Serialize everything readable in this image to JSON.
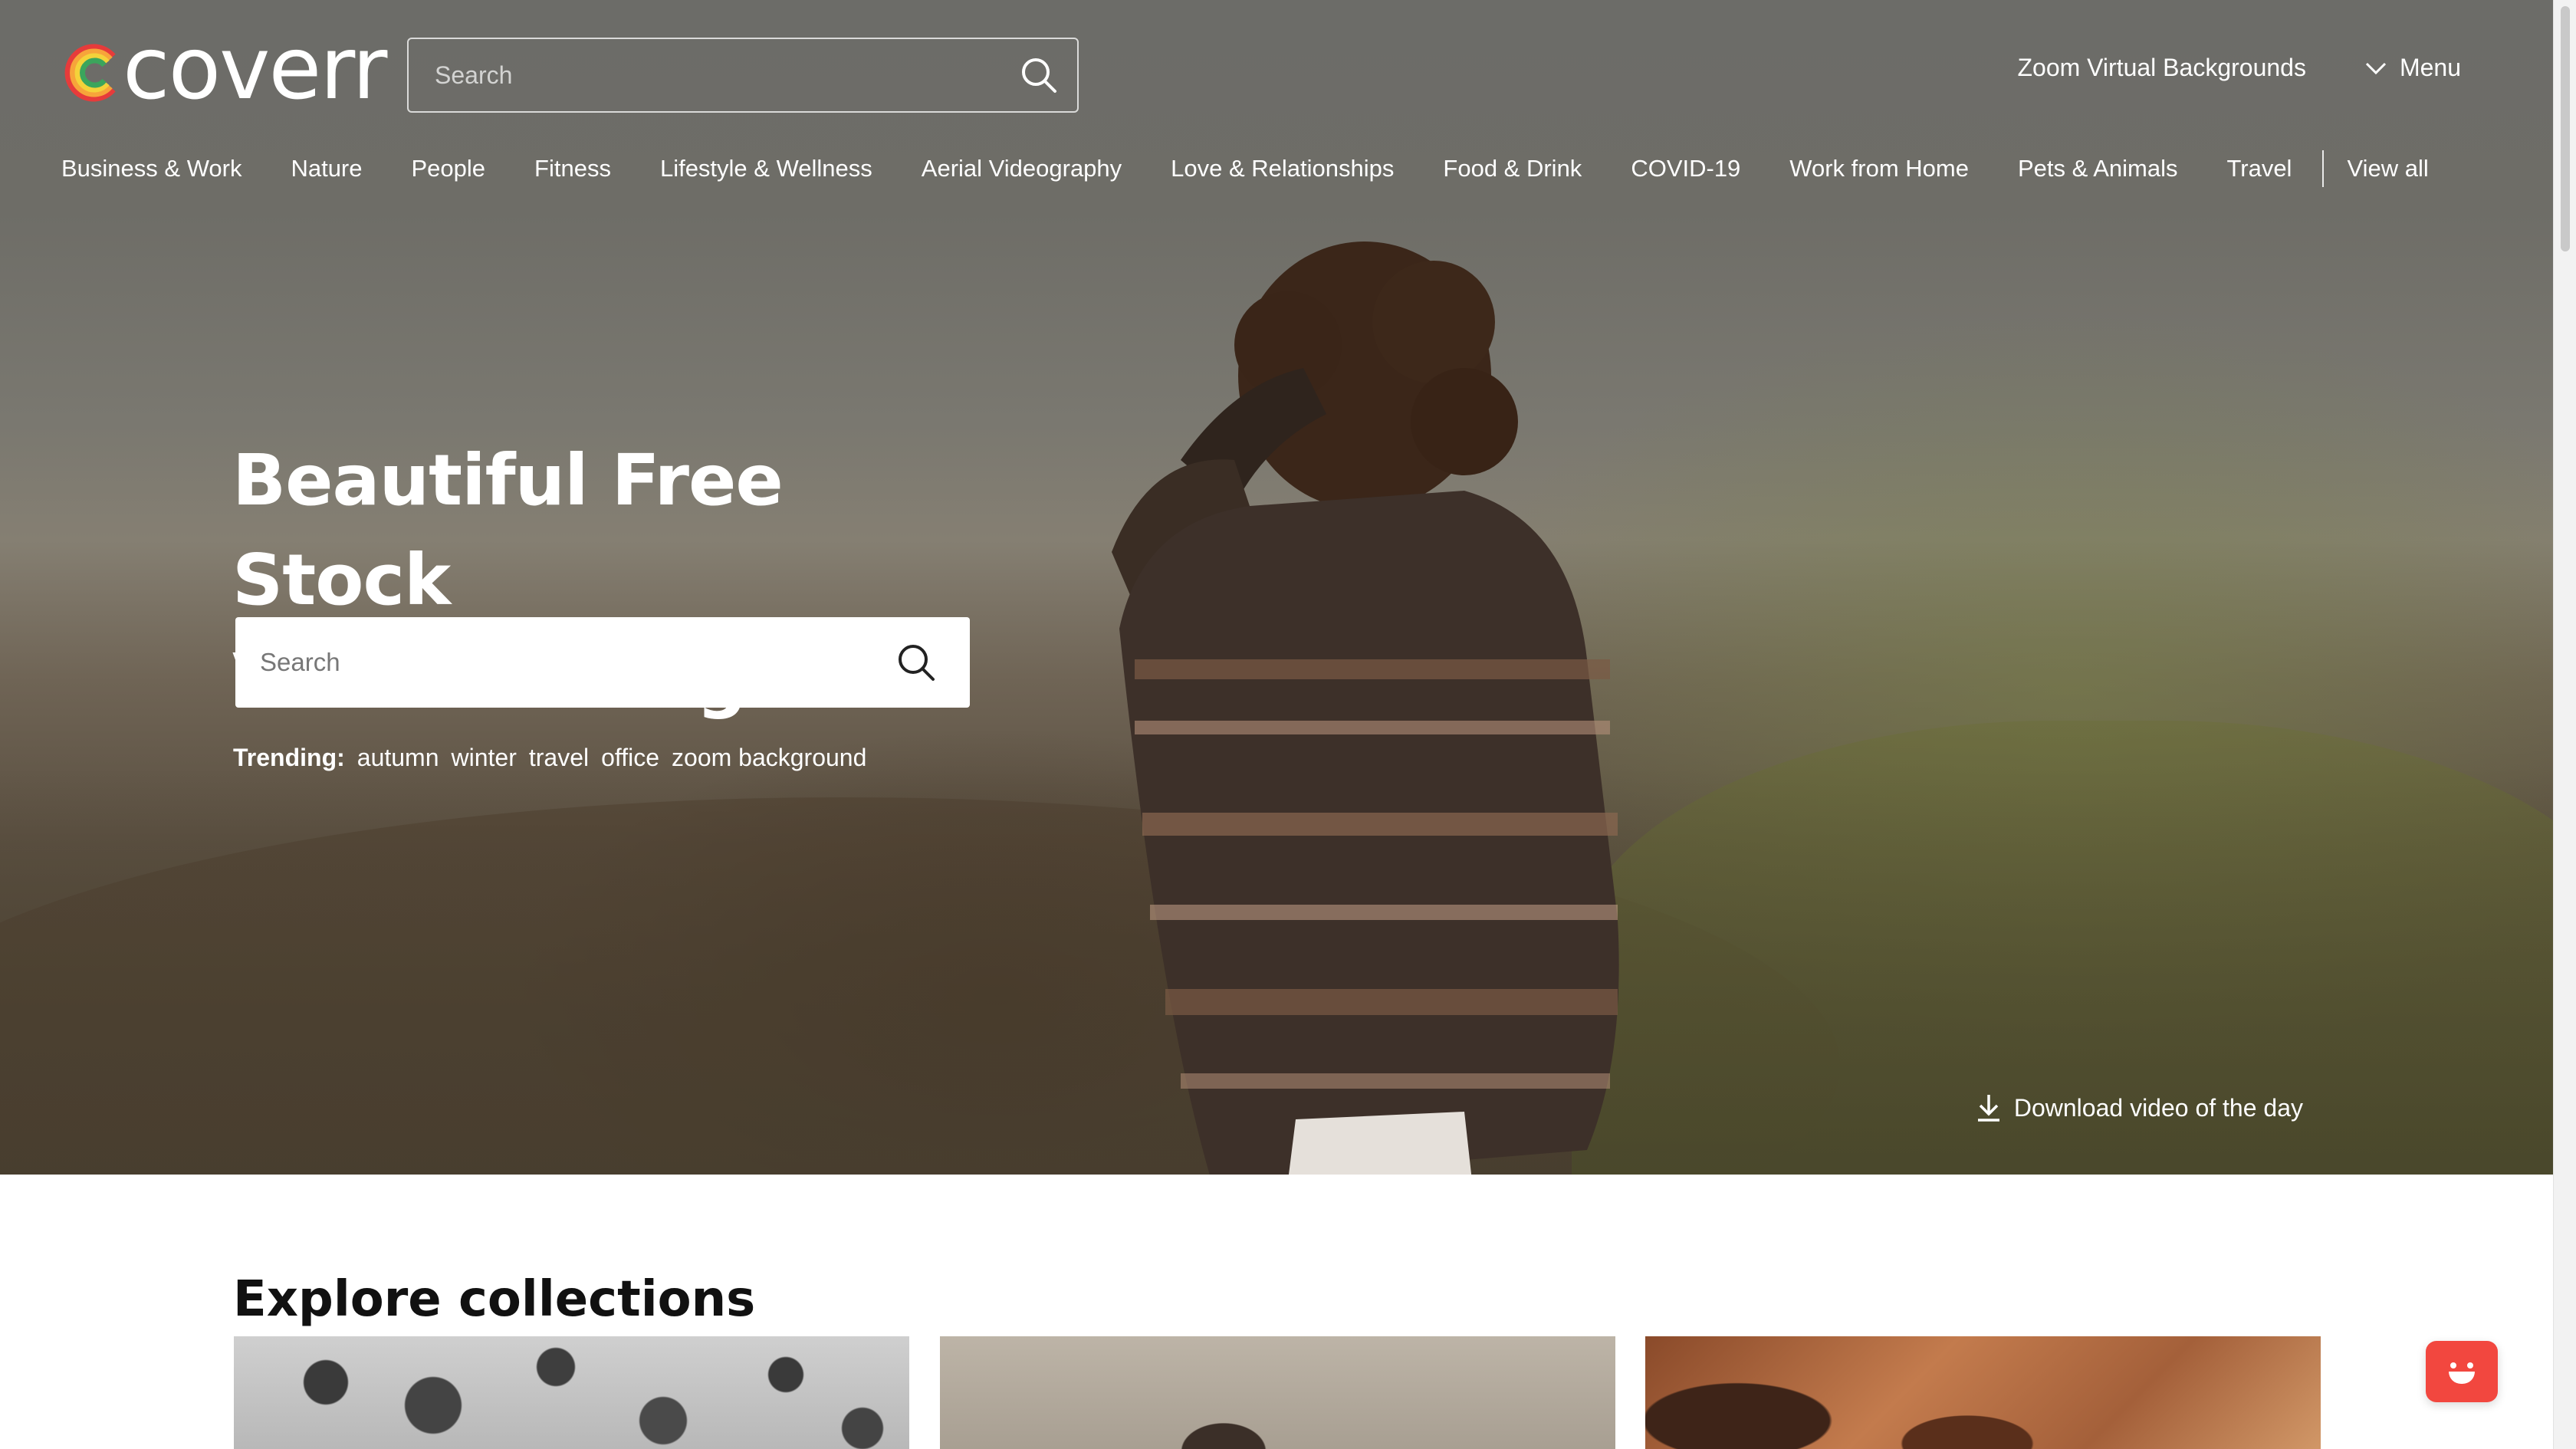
{
  "brand": {
    "name": "coverr"
  },
  "header": {
    "search_placeholder": "Search",
    "zoom_link": "Zoom Virtual Backgrounds",
    "menu_label": "Menu"
  },
  "categories": [
    "Business & Work",
    "Nature",
    "People",
    "Fitness",
    "Lifestyle & Wellness",
    "Aerial Videography",
    "Love & Relationships",
    "Food & Drink",
    "COVID-19",
    "Work from Home",
    "Pets & Animals",
    "Travel"
  ],
  "view_all": "View all",
  "hero": {
    "title_line1": "Beautiful Free Stock",
    "title_line2": "Video Footage",
    "search_placeholder": "Search",
    "trending_label": "Trending:",
    "trending": [
      "autumn",
      "winter",
      "travel",
      "office",
      "zoom background"
    ],
    "download_label": "Download video of the day"
  },
  "collections": {
    "title": "Explore collections"
  },
  "colors": {
    "accent": "#f2473f",
    "logo_rainbow": [
      "#e63b3b",
      "#f7a43a",
      "#f4d23a",
      "#3ba55c",
      "#3b7bd4",
      "#8a4ad6"
    ]
  },
  "icons": {
    "search": "search-icon",
    "chevron": "chevron-down-icon",
    "download": "download-icon",
    "chat": "chat-icon"
  }
}
